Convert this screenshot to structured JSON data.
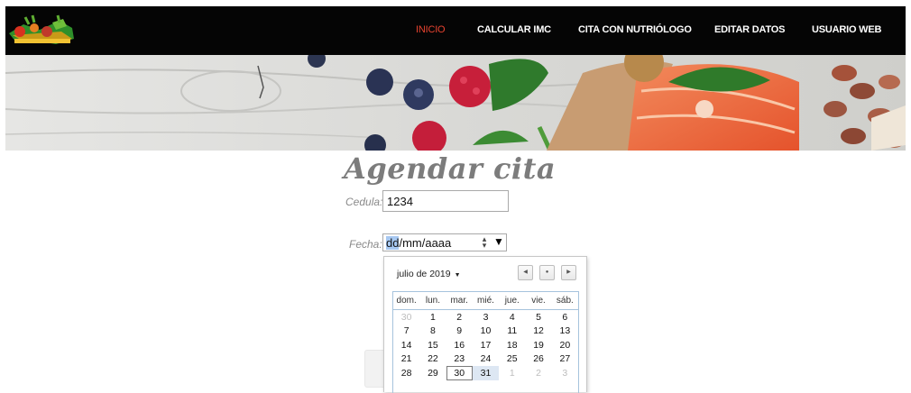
{
  "nav": {
    "items": [
      {
        "label": "INICIO",
        "active": true
      },
      {
        "label": "CALCULAR IMC",
        "active": false
      },
      {
        "label": "CITA CON NUTRIÓLOGO",
        "active": false
      },
      {
        "label": "EDITAR DATOS",
        "active": false
      },
      {
        "label": "USUARIO WEB",
        "active": false
      }
    ]
  },
  "page": {
    "title": "Agendar cita"
  },
  "form": {
    "cedula_label": "Cedula:",
    "cedula_value": "1234",
    "fecha_label": "Fecha:",
    "fecha_day": "dd",
    "fecha_rest": "/mm/aaaa"
  },
  "calendar": {
    "month_label": "julio de 2019",
    "weekdays": [
      "dom.",
      "lun.",
      "mar.",
      "mié.",
      "jue.",
      "vie.",
      "sáb."
    ],
    "weeks": [
      [
        "30",
        "1",
        "2",
        "3",
        "4",
        "5",
        "6"
      ],
      [
        "7",
        "8",
        "9",
        "10",
        "11",
        "12",
        "13"
      ],
      [
        "14",
        "15",
        "16",
        "17",
        "18",
        "19",
        "20"
      ],
      [
        "21",
        "22",
        "23",
        "24",
        "25",
        "26",
        "27"
      ],
      [
        "28",
        "29",
        "30",
        "31",
        "1",
        "2",
        "3"
      ]
    ]
  },
  "colors": {
    "nav_bg": "#050505",
    "nav_active": "#e8432f",
    "title": "#7c7c7c",
    "selected_day": "#dde7f3"
  }
}
